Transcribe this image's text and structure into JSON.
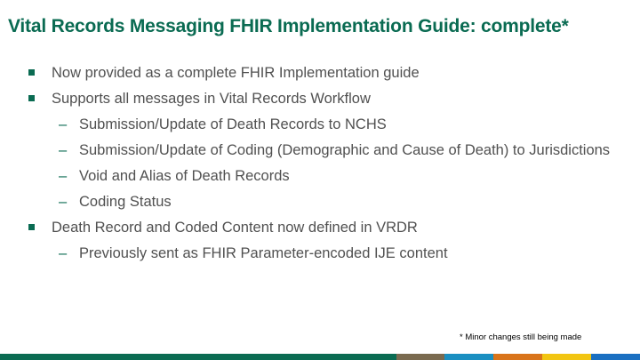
{
  "slide": {
    "title": "Vital Records Messaging FHIR Implementation Guide: complete*",
    "bullets": [
      {
        "level": 1,
        "text": "Now provided as a complete FHIR Implementation guide"
      },
      {
        "level": 1,
        "text": "Supports all messages in Vital Records Workflow"
      },
      {
        "level": 2,
        "text": "Submission/Update of Death Records to NCHS"
      },
      {
        "level": 2,
        "text": "Submission/Update of Coding (Demographic and Cause of Death) to Jurisdictions"
      },
      {
        "level": 2,
        "text": "Void and Alias of Death Records"
      },
      {
        "level": 2,
        "text": "Coding Status"
      },
      {
        "level": 1,
        "text": "Death Record and Coded Content now defined in VRDR"
      },
      {
        "level": 2,
        "text": "Previously sent as FHIR Parameter-encoded IJE content"
      }
    ],
    "dash_glyph": "–",
    "footnote": "* Minor changes still being made"
  },
  "theme": {
    "title_color": "#0a6b52",
    "body_color": "#505050",
    "bullet_color": "#0a6b52",
    "footer_colors": [
      "#0a6b52",
      "#7a6a4f",
      "#1a8fc1",
      "#d9741a",
      "#f2c511",
      "#1a6fc1"
    ]
  }
}
